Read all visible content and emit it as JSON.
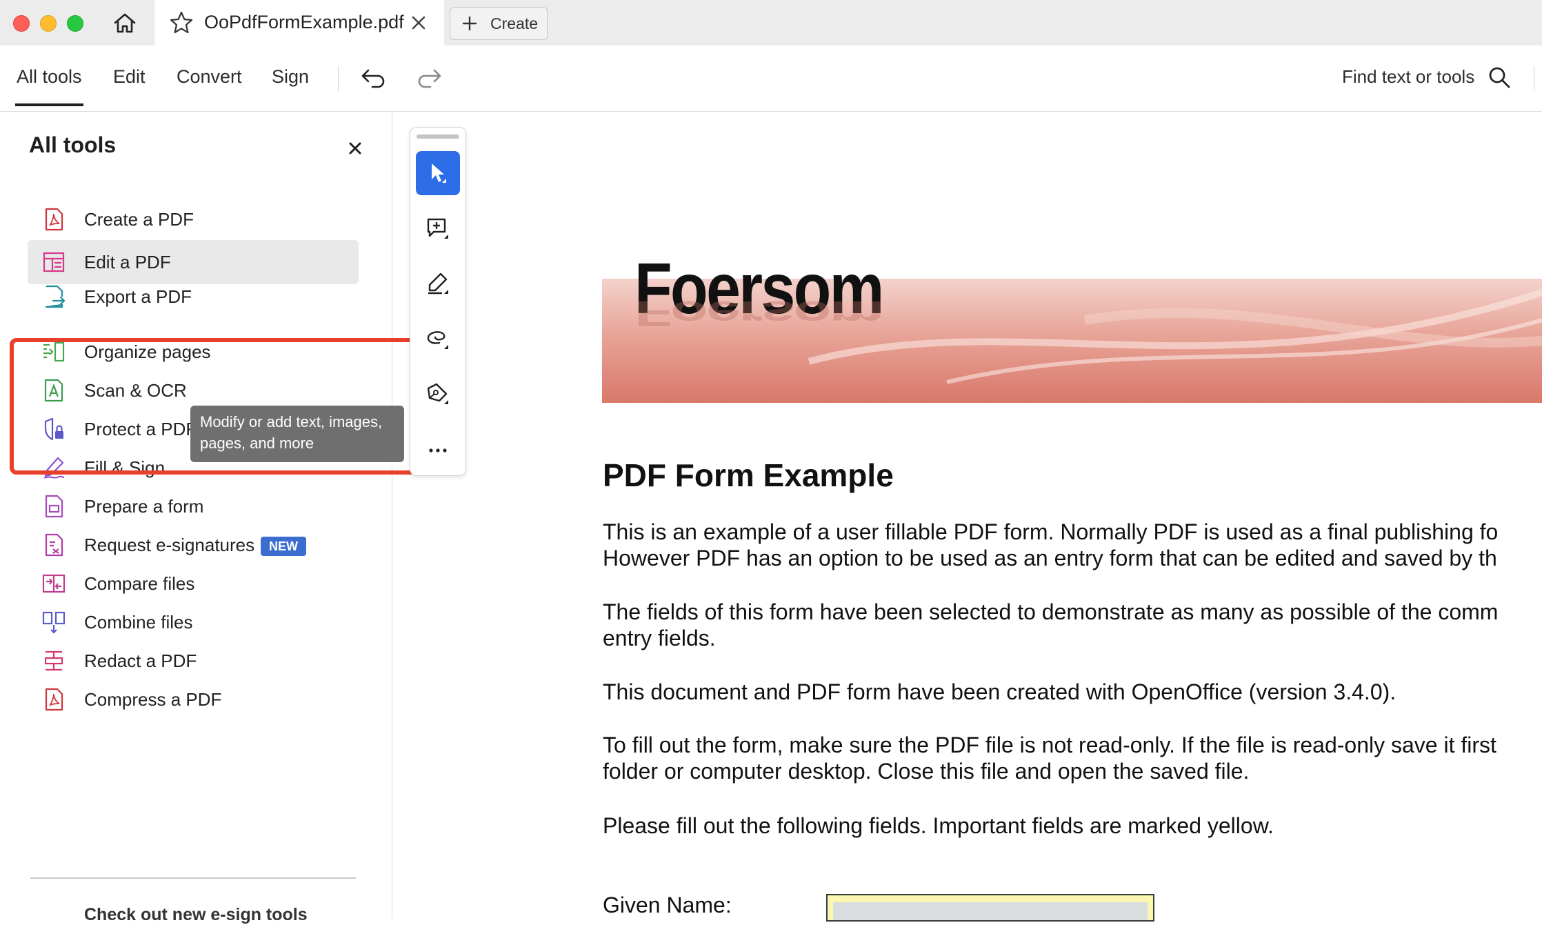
{
  "window": {
    "tab_title": "OoPdfFormExample.pdf",
    "create_label": "Create"
  },
  "toolbar": {
    "menu": [
      "All tools",
      "Edit",
      "Convert",
      "Sign"
    ],
    "active_menu": "All tools",
    "find_label": "Find text or tools"
  },
  "panel": {
    "title": "All tools",
    "tools": [
      {
        "label": "Create a PDF",
        "icon": "create-pdf-icon",
        "color": "#d0343c"
      },
      {
        "label": "Edit a PDF",
        "icon": "edit-pdf-icon",
        "color": "#d7398a"
      },
      {
        "label": "Export a PDF",
        "icon": "export-pdf-icon",
        "color": "#1e8e9e"
      },
      {
        "label": "Organize pages",
        "icon": "organize-pages-icon",
        "color": "#4aa74b"
      },
      {
        "label": "Scan & OCR",
        "icon": "scan-ocr-icon",
        "color": "#3e9b4f"
      },
      {
        "label": "Protect a PDF",
        "icon": "protect-pdf-icon",
        "color": "#5b58c9"
      },
      {
        "label": "Fill & Sign",
        "icon": "fill-sign-icon",
        "color": "#8d4fcf"
      },
      {
        "label": "Prepare a form",
        "icon": "prepare-form-icon",
        "color": "#a64ab8"
      },
      {
        "label": "Request e-signatures",
        "icon": "request-esign-icon",
        "color": "#b43aa8"
      },
      {
        "label": "Compare files",
        "icon": "compare-files-icon",
        "color": "#c23a8b"
      },
      {
        "label": "Combine files",
        "icon": "combine-files-icon",
        "color": "#5a59d0"
      },
      {
        "label": "Redact a PDF",
        "icon": "redact-pdf-icon",
        "color": "#d13a6b"
      },
      {
        "label": "Compress a PDF",
        "icon": "compress-pdf-icon",
        "color": "#d0343c"
      }
    ],
    "new_badge": "NEW",
    "footer": "Check out new e-sign tools",
    "tooltip": "Modify or add text, images, pages, and more"
  },
  "quick_tools": [
    "select-icon",
    "add-comment-icon",
    "highlight-icon",
    "draw-icon",
    "sign-icon",
    "more-icon"
  ],
  "document": {
    "logo": "Foersom",
    "title": "PDF Form Example",
    "paragraphs": [
      [
        "This is an example of a user fillable PDF form. Normally PDF is used as a final publishing fo",
        "However PDF has an option to be used as an entry form that can be edited and saved by th"
      ],
      [
        "The fields of this form have been selected to demonstrate as many as possible of the comm",
        "entry fields."
      ],
      [
        "This document and PDF form have been created with OpenOffice (version 3.4.0)."
      ],
      [
        "To fill out the form, make sure the PDF file is not read-only. If the file is read-only save it first",
        "folder or computer desktop. Close this file and open the saved file."
      ],
      [
        "Please fill out the following fields. Important fields are marked yellow."
      ]
    ],
    "given_name_label": "Given Name:"
  },
  "colors": {
    "accent": "#2d6ee8",
    "highlight_box": "#e8402a",
    "badge": "#3b6dd1",
    "field_yellow": "#fbf7b0"
  }
}
